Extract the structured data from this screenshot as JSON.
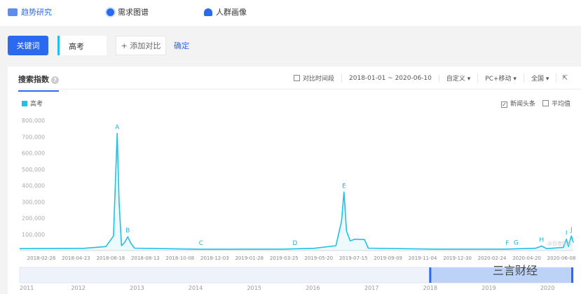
{
  "nav": {
    "items": [
      {
        "label": "趋势研究",
        "icon": "trend-icon"
      },
      {
        "label": "需求图谱",
        "icon": "radar-icon"
      },
      {
        "label": "人群画像",
        "icon": "user-group-icon"
      }
    ]
  },
  "search": {
    "type_button": "关键词",
    "keyword": "高考",
    "add_compare": "+ 添加对比",
    "confirm": "确定"
  },
  "panel": {
    "tab": "搜索指数",
    "help": "?",
    "compare_period": "对比时间段",
    "date_range": "2018-01-01 ~ 2020-06-10",
    "period_select": "自定义",
    "device_select": "PC+移动",
    "region_select": "全国",
    "legend": "高考",
    "news_option": "新闻头条",
    "news_checked": true,
    "avg_option": "平均值",
    "avg_checked": false,
    "watermark": "@百度指数"
  },
  "brand_watermark": "三言财经",
  "chart_data": {
    "type": "line",
    "series": [
      {
        "name": "高考",
        "color": "#1fc1e6",
        "points": [
          [
            "2018-01-01",
            12000
          ],
          [
            "2018-04-15",
            14000
          ],
          [
            "2018-05-20",
            25000
          ],
          [
            "2018-06-01",
            90000
          ],
          [
            "2018-06-04",
            400000
          ],
          [
            "2018-06-07",
            720000
          ],
          [
            "2018-06-10",
            300000
          ],
          [
            "2018-06-14",
            30000
          ],
          [
            "2018-06-19",
            50000
          ],
          [
            "2018-06-24",
            85000
          ],
          [
            "2018-06-29",
            45000
          ],
          [
            "2018-07-05",
            15000
          ],
          [
            "2018-10-20",
            8000
          ],
          [
            "2019-03-01",
            9000
          ],
          [
            "2019-04-20",
            14000
          ],
          [
            "2019-05-25",
            30000
          ],
          [
            "2019-06-03",
            180000
          ],
          [
            "2019-06-07",
            360000
          ],
          [
            "2019-06-11",
            120000
          ],
          [
            "2019-06-17",
            60000
          ],
          [
            "2019-06-24",
            70000
          ],
          [
            "2019-07-10",
            68000
          ],
          [
            "2019-07-16",
            15000
          ],
          [
            "2019-11-01",
            9000
          ],
          [
            "2020-02-20",
            9000
          ],
          [
            "2020-03-20",
            12000
          ],
          [
            "2020-04-10",
            14000
          ],
          [
            "2020-04-20",
            28000
          ],
          [
            "2020-04-28",
            12000
          ],
          [
            "2020-05-25",
            20000
          ],
          [
            "2020-05-30",
            70000
          ],
          [
            "2020-06-02",
            25000
          ],
          [
            "2020-06-07",
            90000
          ],
          [
            "2020-06-10",
            50000
          ]
        ]
      }
    ],
    "annotations": [
      {
        "label": "A",
        "date": "2018-06-07",
        "value": 720000
      },
      {
        "label": "B",
        "date": "2018-06-24",
        "value": 85000
      },
      {
        "label": "C",
        "date": "2018-10-20",
        "value": 8000
      },
      {
        "label": "D",
        "date": "2019-03-20",
        "value": 9000
      },
      {
        "label": "E",
        "date": "2019-06-07",
        "value": 360000
      },
      {
        "label": "F",
        "date": "2020-02-25",
        "value": 9000
      },
      {
        "label": "G",
        "date": "2020-03-10",
        "value": 10000
      },
      {
        "label": "H",
        "date": "2020-04-20",
        "value": 28000
      },
      {
        "label": "I",
        "date": "2020-05-30",
        "value": 70000
      },
      {
        "label": "J",
        "date": "2020-06-07",
        "value": 90000
      }
    ],
    "y_ticks": [
      "100,000",
      "200,000",
      "300,000",
      "400,000",
      "500,000",
      "600,000",
      "700,000",
      "800,000"
    ],
    "x_ticks": [
      "2018-02-26",
      "2018-04-23",
      "2018-06-18",
      "2018-08-13",
      "2018-10-08",
      "2018-12-03",
      "2019-01-28",
      "2019-03-25",
      "2019-05-20",
      "2019-07-15",
      "2019-09-09",
      "2019-11-04",
      "2019-12-30",
      "2020-02-24",
      "2020-04-20",
      "2020-06-08"
    ],
    "xlim": [
      "2018-01-01",
      "2020-06-10"
    ],
    "ylim": [
      0,
      800000
    ],
    "overview_years": [
      "2011",
      "2012",
      "2013",
      "2014",
      "2015",
      "2016",
      "2017",
      "2018",
      "2019",
      "2020"
    ],
    "overview_selection": [
      "2018-01-01",
      "2020-06-10"
    ]
  }
}
